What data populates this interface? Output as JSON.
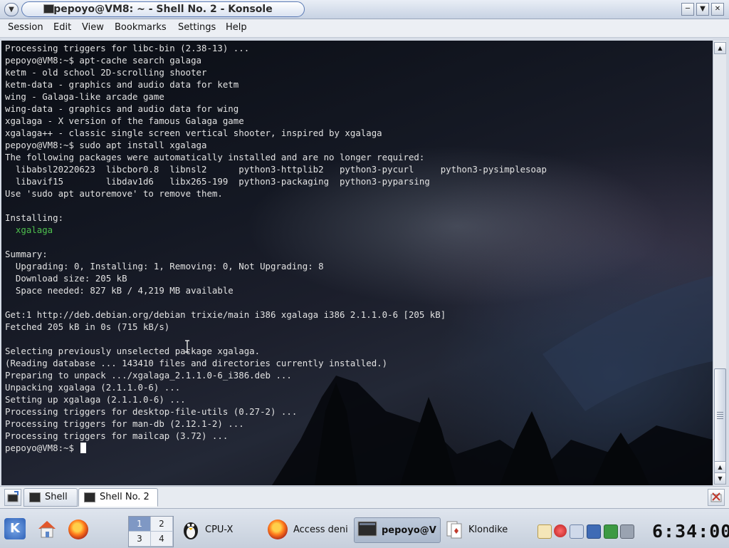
{
  "window": {
    "title": "pepoyo@VM8: ~ - Shell No. 2 - Konsole",
    "buttons": [
      "minimize",
      "maximize",
      "close"
    ]
  },
  "menubar": {
    "items": [
      "Session",
      "Edit",
      "View",
      "Bookmarks",
      "Settings",
      "Help"
    ]
  },
  "terminal": {
    "lines": [
      "Processing triggers for libc-bin (2.38-13) ...",
      "pepoyo@VM8:~$ apt-cache search galaga",
      "ketm - old school 2D-scrolling shooter",
      "ketm-data - graphics and audio data for ketm",
      "wing - Galaga-like arcade game",
      "wing-data - graphics and audio data for wing",
      "xgalaga - X version of the famous Galaga game",
      "xgalaga++ - classic single screen vertical shooter, inspired by xgalaga",
      "pepoyo@VM8:~$ sudo apt install xgalaga",
      "The following packages were automatically installed and are no longer required:",
      "  libabsl20220623  libcbor0.8  libnsl2      python3-httplib2   python3-pycurl     python3-pysimplesoap",
      "  libavif15        libdav1d6   libx265-199  python3-packaging  python3-pyparsing",
      "Use 'sudo apt autoremove' to remove them.",
      "",
      "Installing:",
      "  xgalaga",
      "",
      "Summary:",
      "  Upgrading: 0, Installing: 1, Removing: 0, Not Upgrading: 8",
      "  Download size: 205 kB",
      "  Space needed: 827 kB / 4,219 MB available",
      "",
      "Get:1 http://deb.debian.org/debian trixie/main i386 xgalaga i386 2.1.1.0-6 [205 kB]",
      "Fetched 205 kB in 0s (715 kB/s)",
      "",
      "Selecting previously unselected package xgalaga.",
      "(Reading database ... 143410 files and directories currently installed.)",
      "Preparing to unpack .../xgalaga_2.1.1.0-6_i386.deb ...",
      "Unpacking xgalaga (2.1.1.0-6) ...",
      "Setting up xgalaga (2.1.1.0-6) ...",
      "Processing triggers for desktop-file-utils (0.27-2) ...",
      "Processing triggers for man-db (2.12.1-2) ...",
      "Processing triggers for mailcap (3.72) ..."
    ],
    "prompt": "pepoyo@VM8:~$ ",
    "highlight_color": "#4ec04e",
    "text_color": "#e2e2e2"
  },
  "tabs": [
    {
      "label": "Shell",
      "active": false
    },
    {
      "label": "Shell No. 2",
      "active": true
    }
  ],
  "taskbar": {
    "desktops": [
      "1",
      "2",
      "3",
      "4"
    ],
    "current_desktop": "1",
    "tasks": [
      {
        "label": "CPU-X",
        "icon": "tux-icon"
      },
      {
        "label": "Access deni",
        "icon": "firefox-icon"
      },
      {
        "label": "pepoyo@V",
        "icon": "terminal-icon",
        "active": true
      },
      {
        "label": "Klondike",
        "icon": "cards-icon"
      }
    ],
    "clock": "6:34:00"
  }
}
